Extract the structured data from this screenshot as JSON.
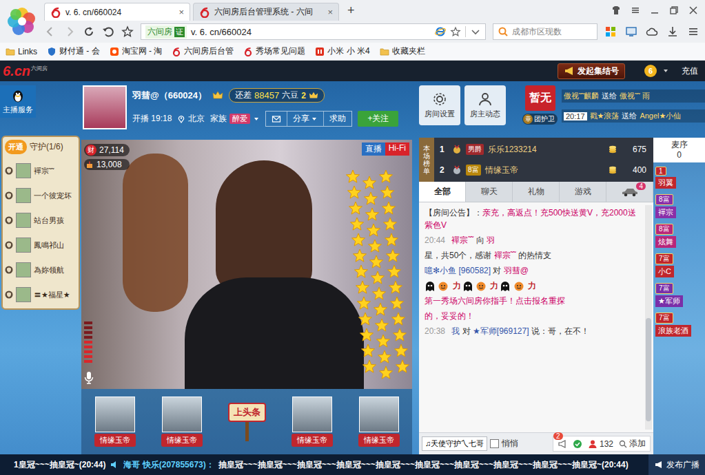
{
  "browser": {
    "tabs": [
      {
        "label": "v. 6. cn/660024",
        "selected": true
      },
      {
        "label": "六间房后台管理系统 - 六间",
        "selected": false
      }
    ],
    "tab_close": "×",
    "new_tab": "+",
    "address": {
      "site": "六间房",
      "cert": "证",
      "url": "v. 6. cn/660024"
    },
    "search": {
      "value": "成都市区现数"
    },
    "bookmarks": [
      "Links",
      "财付通 - 会",
      "淘宝网 - 淘",
      "六间房后台管",
      "秀场常见问题",
      "小米 小 米4",
      "收藏夹栏"
    ]
  },
  "site_header": {
    "logo": "6.cn",
    "logo_sub": "六间房",
    "rally": "发起集结号",
    "coin": "6",
    "recharge": "充值"
  },
  "anchor_service": "主播服务",
  "host": {
    "name": "羽彗@（660024）",
    "need_label": "还差",
    "need_amount": "88457",
    "need_unit": "六豆",
    "next_level": "2",
    "live_label": "开播",
    "live_time": "19:18",
    "city": "北京",
    "family_label": "家族",
    "family": "醉爱"
  },
  "host_actions": [
    "分享",
    "求助"
  ],
  "follow": "+关注",
  "room_buttons": [
    "房间设置",
    "房主动态"
  ],
  "status_badge": "暂无",
  "guard_badge": {
    "icon": "章",
    "label": "团护卫"
  },
  "gift_ticker": {
    "time": "20:17",
    "lines": [
      {
        "from": "傲视˜˜麒麟",
        "verb": "送给",
        "to": "傲视˜˜ 雨"
      },
      {
        "from": "戳★浪荡",
        "verb": "送给",
        "to": "Angel★小仙"
      }
    ]
  },
  "guards": {
    "open": "开通",
    "title": "守护(1/6)",
    "members": [
      "襌宗˜˜",
      "一个彼宠坏",
      "站台男孩",
      "鳳鳴祁山",
      "為妳领航",
      "〓★福星★"
    ]
  },
  "video": {
    "wealth_icon": "财",
    "wealth": "27,114",
    "fans": "13,008",
    "live": "直播",
    "quality": "Hi-Fi"
  },
  "seats": {
    "names": [
      "情缘玉帝",
      "情缘玉帝",
      "情缘玉帝",
      "情缘玉帝"
    ],
    "headline": "上头条"
  },
  "rank": {
    "label": "本场榜单",
    "rows": [
      {
        "rank": "1",
        "badge": "男爵",
        "name": "乐乐1233214",
        "score": "675",
        "color": "#a0282c"
      },
      {
        "rank": "2",
        "badge": "8富",
        "name": "情缘玉帝",
        "score": "400",
        "color": "#b8860b"
      }
    ]
  },
  "chat_tabs": [
    {
      "label": "全部",
      "selected": true
    },
    {
      "label": "聊天",
      "selected": false
    },
    {
      "label": "礼物",
      "selected": false
    },
    {
      "label": "游戏",
      "selected": false
    }
  ],
  "car_badge": "4",
  "messages": [
    {
      "kind": "text",
      "time": "",
      "parts": [
        {
          "text": "【房间公告】：",
          "color": "#333333"
        },
        {
          "text": "亲充，高返点！充500快送黄V，充2000送紫色V",
          "color": "#cc0066"
        }
      ]
    },
    {
      "kind": "text",
      "time": "20:44",
      "parts": [
        {
          "text": "襌宗˜˜",
          "color": "#cc0066"
        },
        {
          "text": " 向 ",
          "color": "#333333"
        },
        {
          "text": "羽",
          "color": "#cc0066"
        }
      ]
    },
    {
      "kind": "text",
      "time": "",
      "parts": [
        {
          "text": "星，共50个，感谢 ",
          "color": "#333333"
        },
        {
          "text": "襌宗˜˜",
          "color": "#cc0066"
        },
        {
          "text": " 的热情支",
          "color": "#333333"
        }
      ]
    },
    {
      "kind": "text",
      "time": "",
      "parts": [
        {
          "text": "噫✻小鱼 [960582]",
          "color": "#3355aa"
        },
        {
          "text": " 对 ",
          "color": "#333333"
        },
        {
          "text": "羽彗@",
          "color": "#cc0066"
        }
      ]
    },
    {
      "kind": "emotes",
      "time": "",
      "emotes": [
        "力",
        "力",
        "力"
      ]
    },
    {
      "kind": "text",
      "time": "",
      "parts": [
        {
          "text": "第一秀场六间房你指手！点击报名重探",
          "color": "#cc0066"
        }
      ]
    },
    {
      "kind": "text",
      "time": "",
      "parts": [
        {
          "text": "的，妥妥的！",
          "color": "#cc0066"
        }
      ]
    },
    {
      "kind": "text",
      "time": "20:38",
      "parts": [
        {
          "text": "我",
          "color": "#3355aa"
        },
        {
          "text": " 对 ",
          "color": "#333333"
        },
        {
          "text": "★军师[969127]",
          "color": "#3355aa"
        },
        {
          "text": " 说：哥，在不！",
          "color": "#333333"
        }
      ]
    }
  ],
  "chat_input": {
    "target": "♫天使守护乀七哥",
    "whisper": {
      "label": "悄悄",
      "checked": false
    },
    "alerts": "2",
    "online": "132",
    "add": "添加"
  },
  "mic_queue": {
    "title": "麦序",
    "count": "0",
    "entries": [
      {
        "badge": "1",
        "name": "羽翼",
        "color": "#c0262d"
      },
      {
        "badge": "8富",
        "name": "襌宗",
        "color": "#8a2fa8"
      },
      {
        "badge": "8富",
        "name": "炫舞",
        "color": "#b8267a"
      },
      {
        "badge": "7富",
        "name": "小C",
        "color": "#c0262d"
      },
      {
        "badge": "7富",
        "name": "★军师",
        "color": "#7a2fa8"
      },
      {
        "badge": "7富",
        "name": "浪族老酒",
        "color": "#c0262d"
      }
    ]
  },
  "broadcast": {
    "lead": "1皇冠~~~抽皇冠~(20:44)",
    "sender": "海哥 快乐(207855673)：",
    "text": "抽皇冠~~~抽皇冠~~~抽皇冠~~~抽皇冠~~~抽皇冠~~~抽皇冠~~~抽皇冠~~~抽皇冠~~~抽皇冠~~~抽皇冠~(20:44)",
    "button": "发布广播"
  }
}
